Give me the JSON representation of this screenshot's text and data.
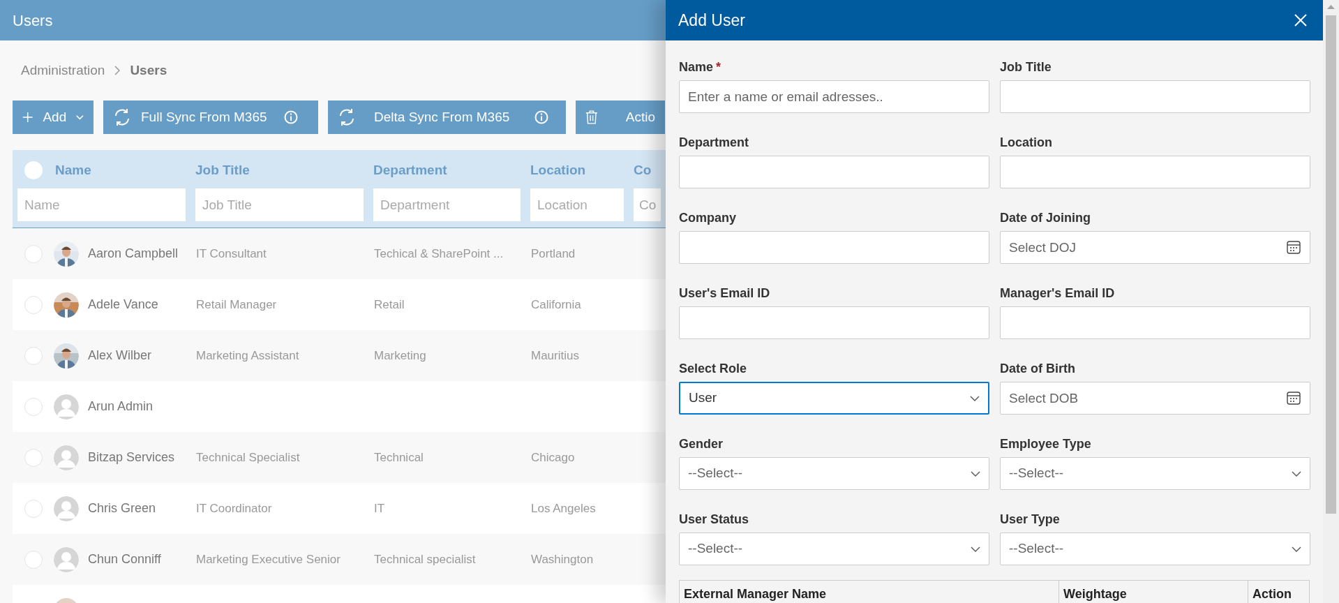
{
  "page": {
    "title": "Users"
  },
  "breadcrumb": [
    {
      "label": "Administration",
      "current": false
    },
    {
      "label": "Users",
      "current": true
    }
  ],
  "toolbar": [
    {
      "kind": "add",
      "label": "Add"
    },
    {
      "kind": "sync",
      "label": "Full Sync From M365"
    },
    {
      "kind": "sync",
      "label": "Delta Sync From M365"
    },
    {
      "kind": "delete",
      "label": "Actio"
    }
  ],
  "table": {
    "select_all": {
      "selected": false
    },
    "columns": [
      {
        "label": "Name",
        "filter_placeholder": "Name"
      },
      {
        "label": "Job Title",
        "filter_placeholder": "Job Title"
      },
      {
        "label": "Department",
        "filter_placeholder": "Department"
      },
      {
        "label": "Location",
        "filter_placeholder": "Location"
      },
      {
        "label": "Co",
        "filter_placeholder": "Co"
      }
    ],
    "rows": [
      {
        "selected": false,
        "avatar": {
          "kind": "picture"
        },
        "name": "Aaron Campbell",
        "job_title": "IT Consultant",
        "department": "Techical & SharePoint ...",
        "location": "Portland"
      },
      {
        "selected": false,
        "avatar": {
          "kind": "picture"
        },
        "name": "Adele Vance",
        "job_title": "Retail Manager",
        "department": "Retail",
        "location": "California"
      },
      {
        "selected": false,
        "avatar": {
          "kind": "picture"
        },
        "name": "Alex Wilber",
        "job_title": "Marketing Assistant",
        "department": "Marketing",
        "location": "Mauritius"
      },
      {
        "selected": false,
        "avatar": {
          "kind": "silhouette"
        },
        "name": "Arun Admin"
      },
      {
        "selected": false,
        "avatar": {
          "kind": "silhouette"
        },
        "name": "Bitzap Services",
        "job_title": "Technical Specialist",
        "department": "Technical",
        "location": "Chicago"
      },
      {
        "selected": false,
        "avatar": {
          "kind": "silhouette"
        },
        "name": "Chris Green",
        "job_title": "IT Coordinator",
        "department": "IT",
        "location": "Los Angeles"
      },
      {
        "selected": false,
        "avatar": {
          "kind": "silhouette"
        },
        "name": "Chun Conniff",
        "job_title": "Marketing Executive Senior",
        "department": "Technical specialist",
        "location": "Washington"
      },
      {
        "avatar": {
          "kind": "picture"
        }
      }
    ]
  },
  "panel": {
    "title": "Add User",
    "fields": [
      {
        "kind": "text",
        "label": "Name",
        "required_mark": "*",
        "placeholder": "Enter a name or email adresses..",
        "focused": false
      },
      {
        "kind": "text",
        "label": "Job Title",
        "focused": false
      },
      {
        "kind": "text",
        "label": "Department",
        "focused": false
      },
      {
        "kind": "text",
        "label": "Location",
        "focused": false
      },
      {
        "kind": "text",
        "label": "Company",
        "focused": false
      },
      {
        "kind": "date",
        "label": "Date of Joining",
        "placeholder": "Select DOJ",
        "focused": false
      },
      {
        "kind": "text",
        "label": "User's Email ID",
        "focused": false
      },
      {
        "kind": "text",
        "label": "Manager's Email ID",
        "focused": false
      },
      {
        "kind": "select",
        "label": "Select Role",
        "value": "User",
        "focused": true
      },
      {
        "kind": "date",
        "label": "Date of Birth",
        "placeholder": "Select DOB",
        "focused": false
      },
      {
        "kind": "select",
        "label": "Gender",
        "placeholder": "--Select--",
        "focused": false
      },
      {
        "kind": "select",
        "label": "Employee Type",
        "placeholder": "--Select--",
        "focused": false
      },
      {
        "kind": "select",
        "label": "User Status",
        "placeholder": "--Select--",
        "focused": false
      },
      {
        "kind": "select",
        "label": "User Type",
        "placeholder": "--Select--",
        "focused": false
      }
    ],
    "manager_table": {
      "columns": [
        "External Manager Name",
        "Weightage",
        "Action"
      ]
    }
  }
}
